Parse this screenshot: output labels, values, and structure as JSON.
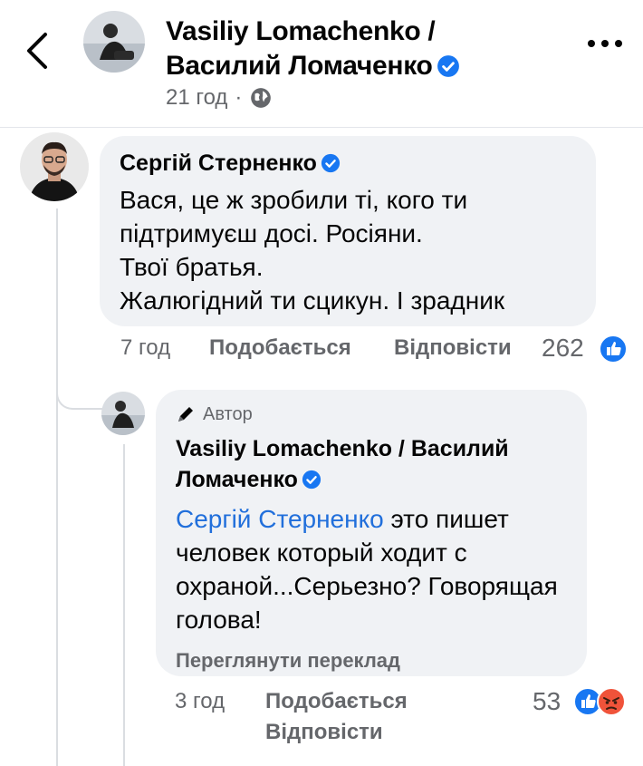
{
  "header": {
    "title": "Vasiliy Lomachenko / Василий Ломаченко",
    "time": "21 год",
    "separator": "·"
  },
  "comments": [
    {
      "author": "Сергій Стерненко",
      "text": "Вася, це ж зробили ті, кого ти підтримуєш досі. Росіяни.\nТвої братья.\nЖалюгідний ти сцикун. І зрадник",
      "time": "7 год",
      "like_label": "Подобається",
      "reply_label": "Відповісти",
      "reaction_count": "262",
      "reactions": [
        "like-icon"
      ]
    },
    {
      "badge": "Автор",
      "author": "Vasiliy Lomachenko / Василий Ломаченко",
      "mention": "Сергій Стерненко",
      "text": " это пишет человек который ходит с охраной...Серьезно? Говорящая голова!",
      "translate_label": "Переглянути переклад",
      "time": "3 год",
      "like_label": "Подобається",
      "reply_label": "Відповісти",
      "reaction_count": "53",
      "reactions": [
        "like-icon",
        "angry-icon"
      ]
    }
  ],
  "colors": {
    "accent": "#1877f2",
    "mention": "#216fdb",
    "bubble": "#f0f2f5",
    "secondary_text": "#65676b",
    "angry": "#f0533a"
  }
}
